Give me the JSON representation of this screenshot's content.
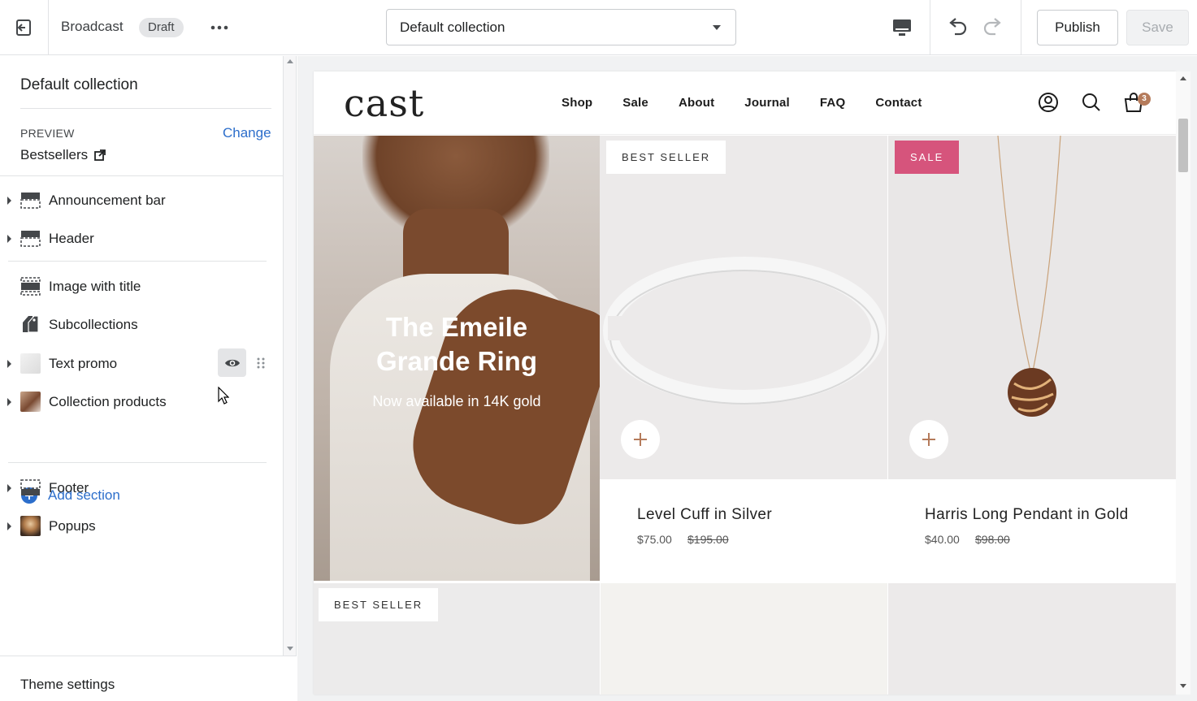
{
  "topbar": {
    "theme_name": "Broadcast",
    "status_badge": "Draft",
    "template_select": "Default collection",
    "publish_label": "Publish",
    "save_label": "Save"
  },
  "sidebar": {
    "title": "Default collection",
    "preview_label": "PREVIEW",
    "change_label": "Change",
    "preview_value": "Bestsellers",
    "header_group": [
      {
        "label": "Announcement bar",
        "icon": "section-layout-icon"
      },
      {
        "label": "Header",
        "icon": "section-layout-icon"
      }
    ],
    "template_group": [
      {
        "label": "Image with title",
        "icon": "image-section-icon"
      },
      {
        "label": "Subcollections",
        "icon": "tags-icon"
      },
      {
        "label": "Text promo",
        "icon": "thumbnail-image"
      },
      {
        "label": "Collection products",
        "icon": "thumbnail-image"
      }
    ],
    "add_section_label": "Add section",
    "footer_group": [
      {
        "label": "Footer",
        "icon": "section-layout-icon"
      },
      {
        "label": "Popups",
        "icon": "thumbnail-image"
      }
    ],
    "theme_settings_label": "Theme settings"
  },
  "store": {
    "logo": "cast",
    "nav": [
      "Shop",
      "Sale",
      "About",
      "Journal",
      "FAQ",
      "Contact"
    ],
    "cart_count": "3",
    "hero": {
      "title_line1": "The Emeile",
      "title_line2": "Grande Ring",
      "subtitle": "Now available in 14K gold"
    },
    "products": [
      {
        "badge": "BEST SELLER",
        "name": "Level Cuff in Silver",
        "price": "$75.00",
        "compare_price": "$195.00"
      },
      {
        "badge": "SALE",
        "name": "Harris Long Pendant in Gold",
        "price": "$40.00",
        "compare_price": "$98.00"
      }
    ],
    "row2_badge": "BEST SELLER"
  },
  "colors": {
    "link": "#2c6ecb",
    "sale_badge": "#d6547c",
    "accent": "#b57b5b"
  }
}
